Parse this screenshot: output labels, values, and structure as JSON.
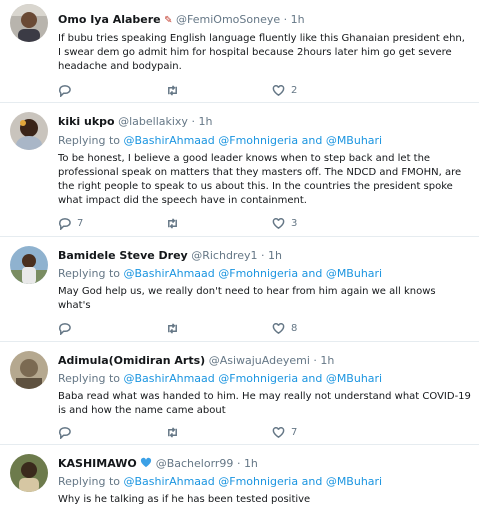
{
  "tweets": [
    {
      "name": "Omo Iya Alabere",
      "handle": "@FemiOmoSoneye",
      "dot": "·",
      "time": "1h",
      "replying_prefix": "",
      "mentions": [],
      "and": "",
      "text": "If bubu tries speaking English language fluently like this Ghanaian president ehn, I swear dem go admit him for hospital because 2hours later him go get severe headache and bodypain.",
      "reply_count": "",
      "retweet_count": "",
      "like_count": "2"
    },
    {
      "name": "kiki ukpo",
      "handle": "@labellakixy",
      "dot": "·",
      "time": "1h",
      "replying_prefix": "Replying to",
      "mentions": [
        "@BashirAhmaad",
        "@Fmohnigeria"
      ],
      "and": "and",
      "last_mention": "@MBuhari",
      "text": "To be honest, I believe a good leader knows when to step back and let the professional speak on matters that they masters off. The NDCD and FMOHN, are the right people to speak to us about this. In the countries the president spoke what impact did the speech have in containment.",
      "reply_count": "7",
      "retweet_count": "",
      "like_count": "3"
    },
    {
      "name": "Bamidele Steve Drey",
      "handle": "@Richdrey1",
      "dot": "·",
      "time": "1h",
      "replying_prefix": "Replying to",
      "mentions": [
        "@BashirAhmaad",
        "@Fmohnigeria"
      ],
      "and": "and",
      "last_mention": "@MBuhari",
      "text": "May God help us,  we really don't need to hear from him again we all knows what's",
      "reply_count": "",
      "retweet_count": "",
      "like_count": "8"
    },
    {
      "name": "Adimula(Omidiran Arts)",
      "handle": "@AsiwajuAdeyemi",
      "dot": "·",
      "time": "1h",
      "replying_prefix": "Replying to",
      "mentions": [
        "@BashirAhmaad",
        "@Fmohnigeria"
      ],
      "and": "and",
      "last_mention": "@MBuhari",
      "text": "Baba read what was handed to him. He may really not understand what COVID-19 is and how the name came about",
      "reply_count": "",
      "retweet_count": "",
      "like_count": "7"
    },
    {
      "name": "KASHIMAWO",
      "handle": "@Bachelorr99",
      "dot": "·",
      "time": "1h",
      "replying_prefix": "Replying to",
      "mentions": [
        "@BashirAhmaad",
        "@Fmohnigeria"
      ],
      "and": "and",
      "last_mention": "@MBuhari",
      "text": "Why is he talking as if he has been tested positive",
      "reply_count": "",
      "retweet_count": "",
      "like_count": ""
    }
  ],
  "colors": {
    "link": "#1b95e0",
    "muted": "#657786",
    "divider": "#e6ecf0",
    "heart_badge": "#3ba0e6"
  },
  "icons": [
    "reply-icon",
    "retweet-icon",
    "like-icon",
    "share-icon",
    "blue-heart-icon",
    "flag-emoji-icon"
  ]
}
